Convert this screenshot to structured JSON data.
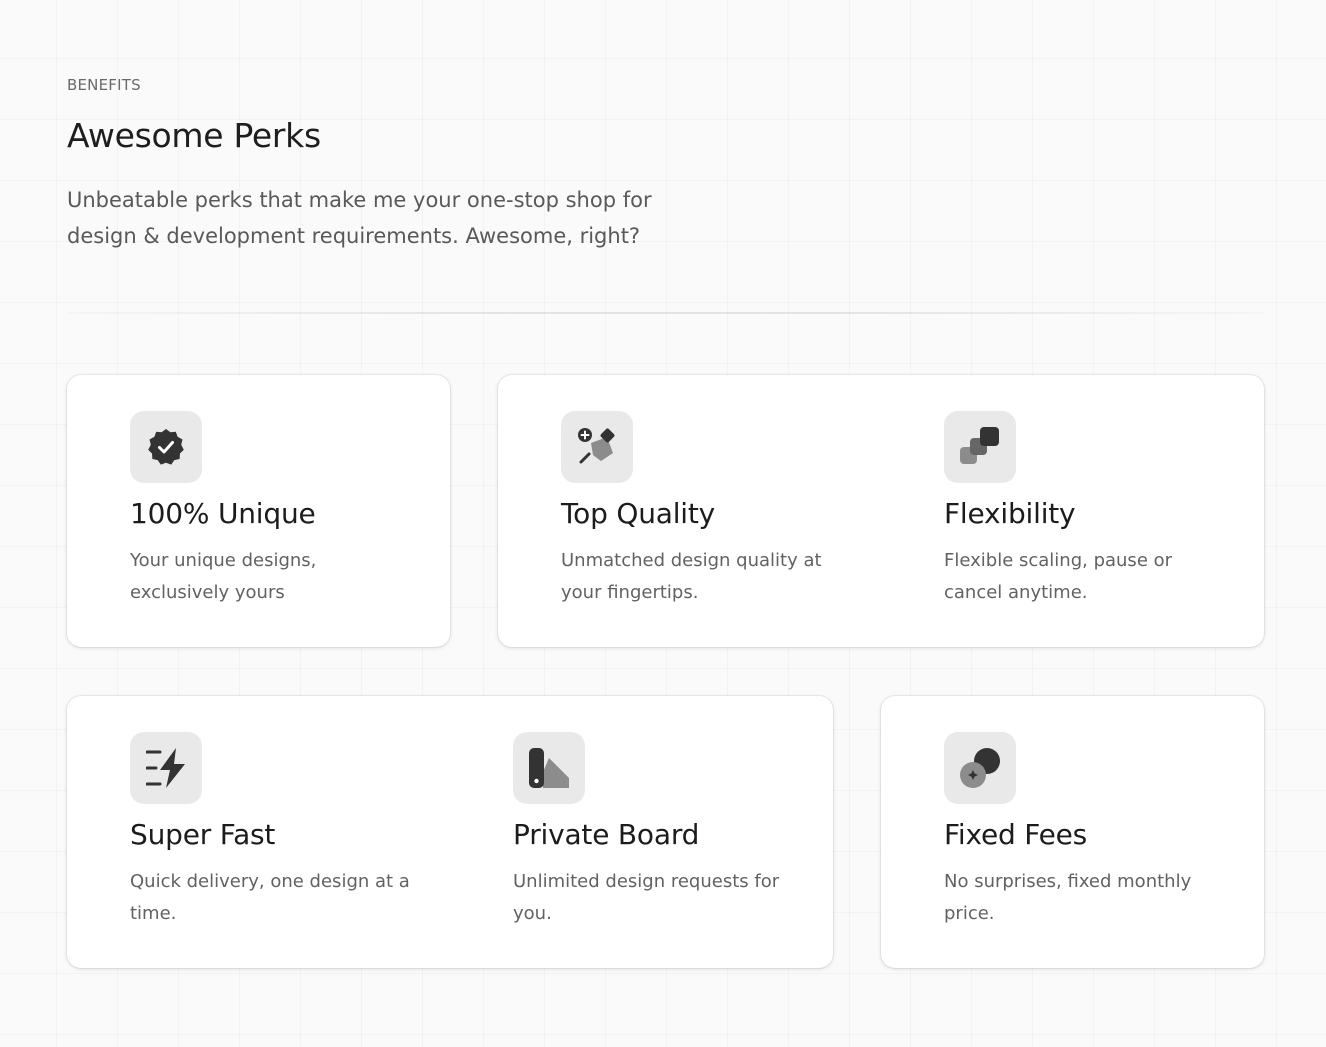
{
  "section": {
    "eyebrow": "BENEFITS",
    "title": "Awesome Perks",
    "subtitle": "Unbeatable perks that make me your one-stop shop for design & development requirements. Awesome, right?"
  },
  "perks": [
    {
      "icon": "verified-badge-icon",
      "title": "100% Unique",
      "description": "Your unique designs, exclusively yours"
    },
    {
      "icon": "design-tools-icon",
      "title": "Top Quality",
      "description": "Unmatched design quality at your fingertips."
    },
    {
      "icon": "layers-icon",
      "title": "Flexibility",
      "description": "Flexible scaling, pause or cancel anytime."
    },
    {
      "icon": "lightning-icon",
      "title": "Super Fast",
      "description": "Quick delivery, one design at a time."
    },
    {
      "icon": "swatch-board-icon",
      "title": "Private Board",
      "description": "Unlimited design requests for you."
    },
    {
      "icon": "coins-sparkle-icon",
      "title": "Fixed Fees",
      "description": "No surprises, fixed monthly price."
    }
  ],
  "colors": {
    "background": "#fafafa",
    "card": "#ffffff",
    "icon_tile": "#e9e9e9",
    "icon_dark": "#333333",
    "icon_mid": "#8c8c8c",
    "heading": "#1c1c1c",
    "body_text": "#626262"
  }
}
